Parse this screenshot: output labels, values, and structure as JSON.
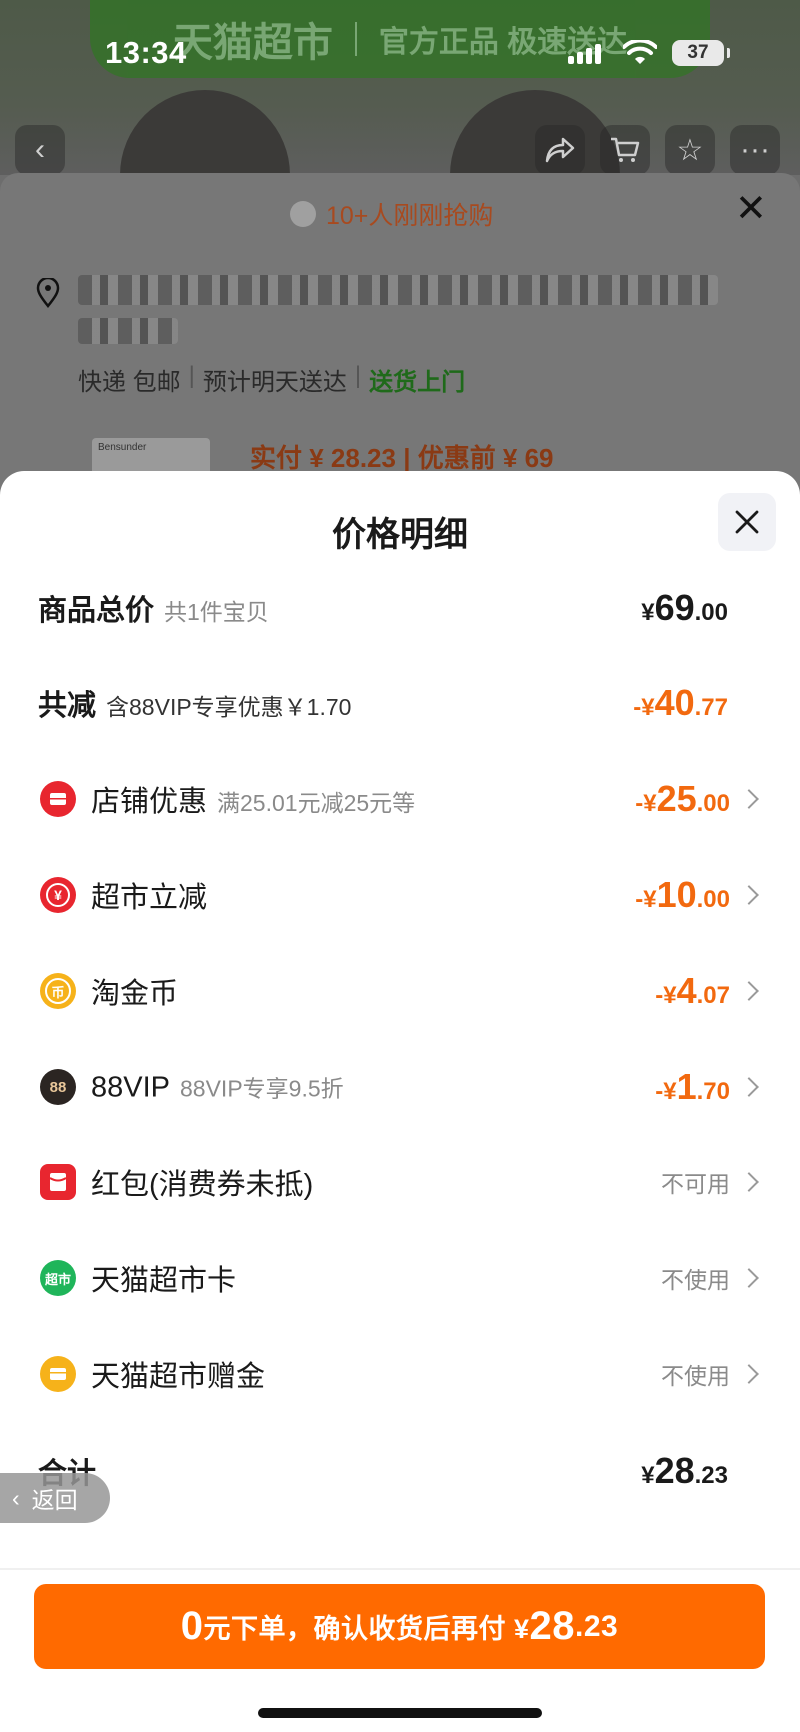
{
  "status_bar": {
    "time": "13:34",
    "battery": "37"
  },
  "background": {
    "banner": [
      "天猫超市",
      "官方正品 极速送达"
    ],
    "hot_text": "10+人刚刚抢购",
    "address_line2": "",
    "shipping": {
      "express": "快递 包邮",
      "eta": "预计明天送达",
      "delivery": "送货上门"
    },
    "thumb_brand": "Bensunder",
    "price_text": "实付 ¥ 28.23 | 优惠前 ¥ 69"
  },
  "sheet": {
    "title": "价格明细",
    "rows": [
      {
        "label": "商品总价",
        "sub": "共1件宝贝",
        "cur": "¥",
        "int": "69",
        "dec": ".00"
      },
      {
        "label": "共减",
        "sub": "含88VIP专享优惠￥1.70",
        "cur": "-¥",
        "int": "40",
        "dec": ".77"
      },
      {
        "label": "店铺优惠",
        "sub": "满25.01元减25元等",
        "cur": "-¥",
        "int": "25",
        "dec": ".00"
      },
      {
        "label": "超市立减",
        "sub": "",
        "cur": "-¥",
        "int": "10",
        "dec": ".00"
      },
      {
        "label": "淘金币",
        "sub": "",
        "cur": "-¥",
        "int": "4",
        "dec": ".07"
      },
      {
        "label": "88VIP",
        "sub": "88VIP专享9.5折",
        "cur": "-¥",
        "int": "1",
        "dec": ".70"
      },
      {
        "label": "红包(消费券未抵)",
        "status": "不可用"
      },
      {
        "label": "天猫超市卡",
        "status": "不使用"
      },
      {
        "label": "天猫超市赠金",
        "status": "不使用"
      },
      {
        "label": "合计",
        "cur": "¥",
        "int": "28",
        "dec": ".23"
      }
    ],
    "back_label": "返回",
    "cta": {
      "zero": "0",
      "text": "元下单，确认收货后再付 ¥",
      "int": "28",
      "dec": ".23"
    }
  },
  "icons": {
    "shop": "shop-coupon-icon",
    "market": "market-discount-icon",
    "coin": "taojinbi-icon",
    "vip": "88vip-icon",
    "redpack": "red-packet-icon",
    "card": "tmall-market-card-icon",
    "gift": "gift-money-icon"
  },
  "colors": {
    "accent": "#ff6a00",
    "discount": "#f2690f",
    "muted": "#8a8a8a"
  }
}
